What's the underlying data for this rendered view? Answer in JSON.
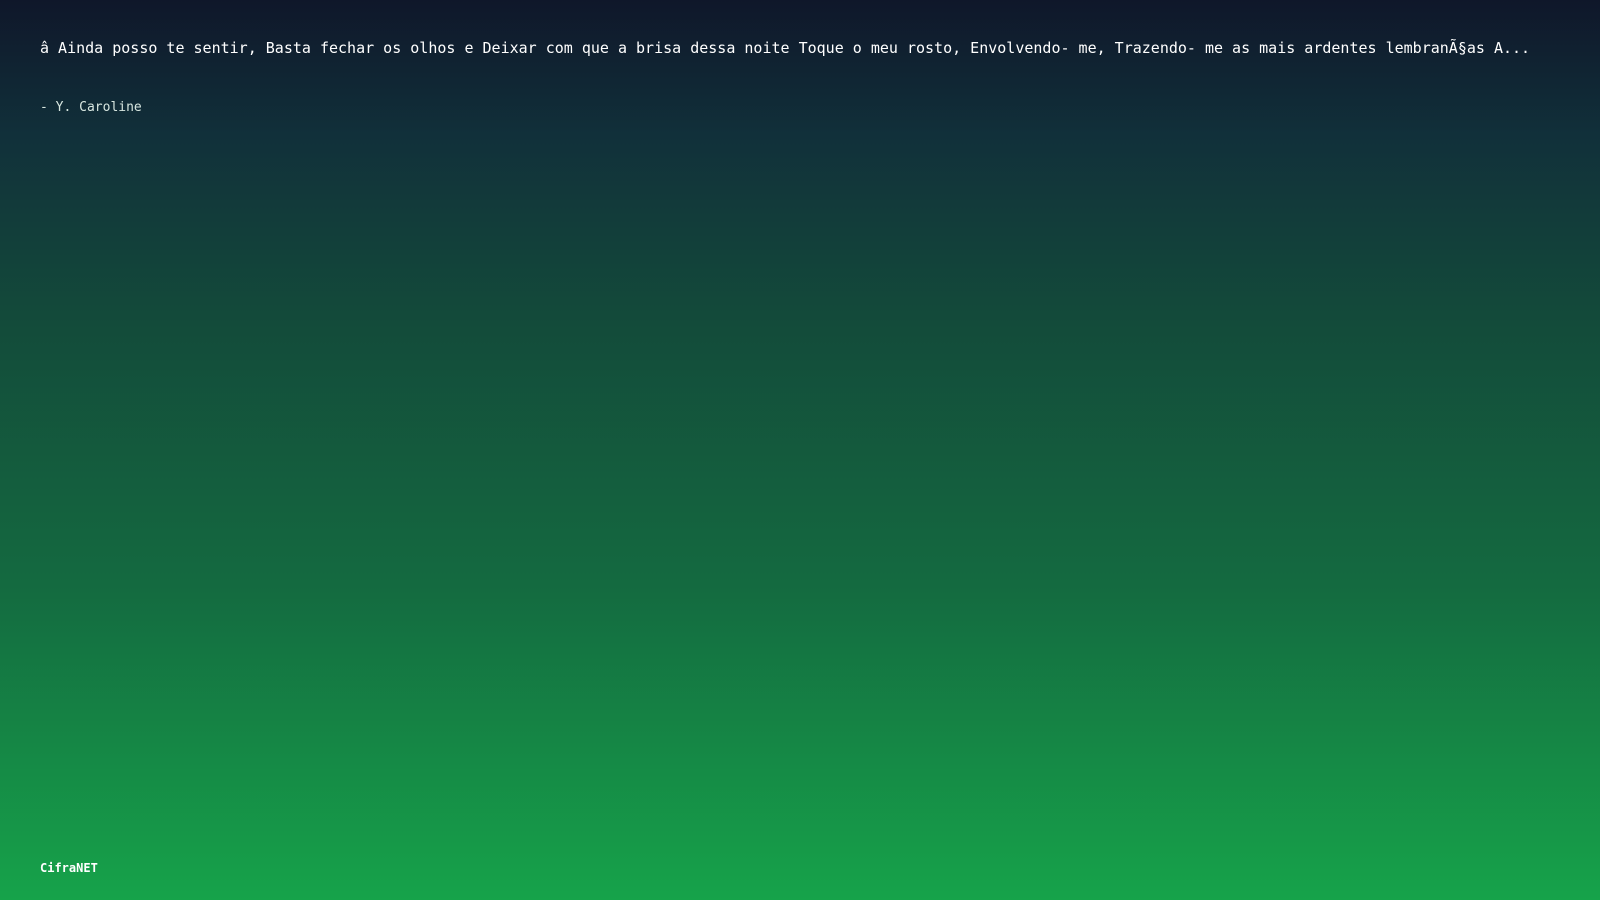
{
  "quote": {
    "text": "â  Ainda posso te sentir, Basta fechar os olhos e Deixar com que a brisa dessa noite Toque o meu rosto, Envolvendo- me, Trazendo- me as mais ardentes lembranÃ§as A...",
    "author": "- Y. Caroline"
  },
  "footer": {
    "brand": "CifraNET"
  },
  "colors": {
    "gradient_top": "#0f172a",
    "gradient_bottom": "#16a34a",
    "text": "#ffffff"
  }
}
